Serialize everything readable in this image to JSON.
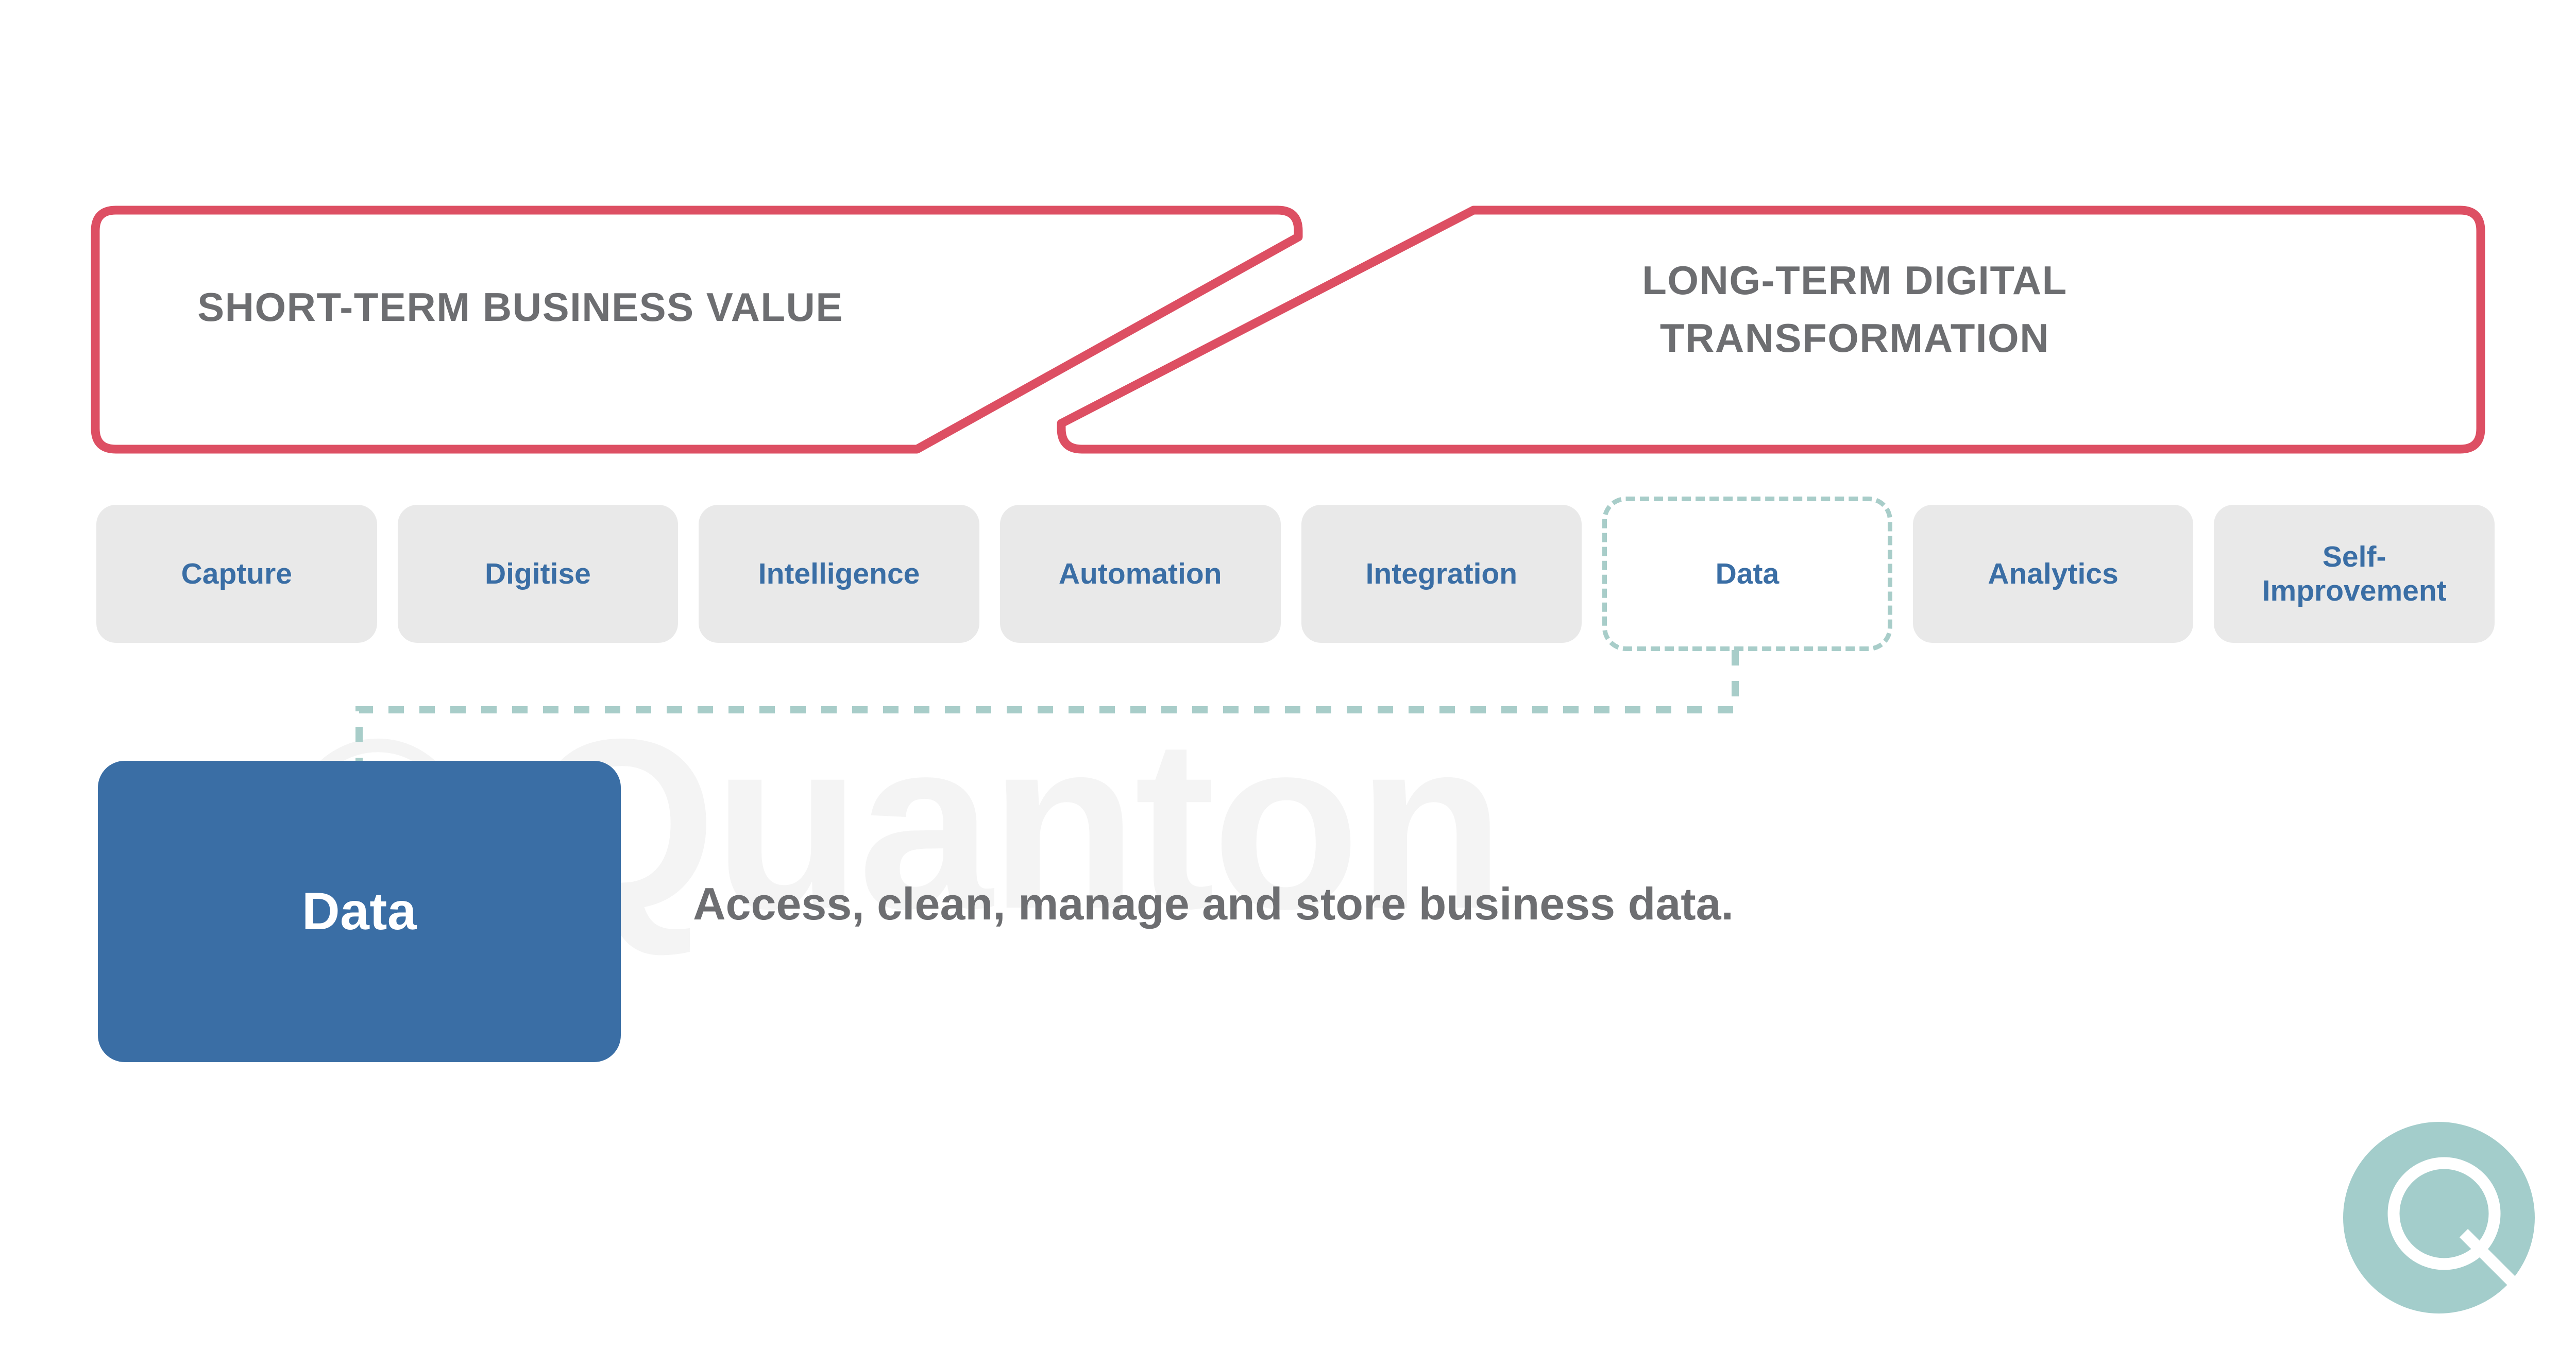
{
  "slide": {
    "watermark_text": "© Quanton",
    "background_color": "#ffffff"
  },
  "colors": {
    "banner_outline": "#dd4f63",
    "banner_text": "#6d6e71",
    "chip_fill": "#e9e9e9",
    "chip_text": "#3a6ea5",
    "chip_active_border": "#a8cdc9",
    "connector": "#a8cdc9",
    "detail_fill": "#3a6ea5",
    "detail_text": "#ffffff",
    "description_text": "#6d6e71",
    "logo_fill": "#a3cdcb",
    "watermark": "#f4f4f4"
  },
  "banners": [
    {
      "id": "short-term",
      "label": "SHORT-TERM BUSINESS VALUE"
    },
    {
      "id": "long-term",
      "label": "LONG-TERM DIGITAL\nTRANSFORMATION"
    }
  ],
  "capability_chips": [
    {
      "label": "Capture",
      "active": false
    },
    {
      "label": "Digitise",
      "active": false
    },
    {
      "label": "Intelligence",
      "active": false
    },
    {
      "label": "Automation",
      "active": false
    },
    {
      "label": "Integration",
      "active": false
    },
    {
      "label": "Data",
      "active": true
    },
    {
      "label": "Analytics",
      "active": false
    },
    {
      "label": "Self-\nImprovement",
      "active": false
    }
  ],
  "detail": {
    "title": "Data",
    "description": "Access, clean, manage and store business data."
  },
  "logo": {
    "name": "quanton-q-logo"
  }
}
